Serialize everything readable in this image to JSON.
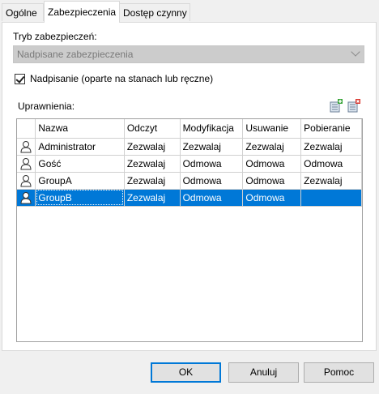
{
  "tabs": [
    {
      "label": "Ogólne"
    },
    {
      "label": "Zabezpieczenia"
    },
    {
      "label": "Dostęp czynny"
    }
  ],
  "security": {
    "mode_label": "Tryb zabezpieczeń:",
    "mode_value": "Nadpisane zabezpieczenia",
    "override_label": "Nadpisanie (oparte na stanach lub ręczne)",
    "override_checked": true,
    "permissions_label": "Uprawnienia:"
  },
  "permissions": {
    "headers": [
      "Nazwa",
      "Odczyt",
      "Modyfikacja",
      "Usuwanie",
      "Pobieranie"
    ],
    "rows": [
      {
        "name": "Administrator",
        "read": "Zezwalaj",
        "modify": "Zezwalaj",
        "delete": "Zezwalaj",
        "download": "Zezwalaj"
      },
      {
        "name": "Gość",
        "read": "Zezwalaj",
        "modify": "Odmowa",
        "delete": "Odmowa",
        "download": "Odmowa"
      },
      {
        "name": "GroupA",
        "read": "Zezwalaj",
        "modify": "Odmowa",
        "delete": "Odmowa",
        "download": "Zezwalaj"
      },
      {
        "name": "GroupB",
        "read": "Zezwalaj",
        "modify": "Odmowa",
        "delete": "Odmowa",
        "download": ""
      }
    ],
    "selected_row": "GroupB",
    "selection_color": "#0078d7"
  },
  "toolbar_icons": [
    "add-permission-icon",
    "remove-permission-icon"
  ],
  "buttons": {
    "ok": "OK",
    "cancel": "Anuluj",
    "help": "Pomoc"
  }
}
